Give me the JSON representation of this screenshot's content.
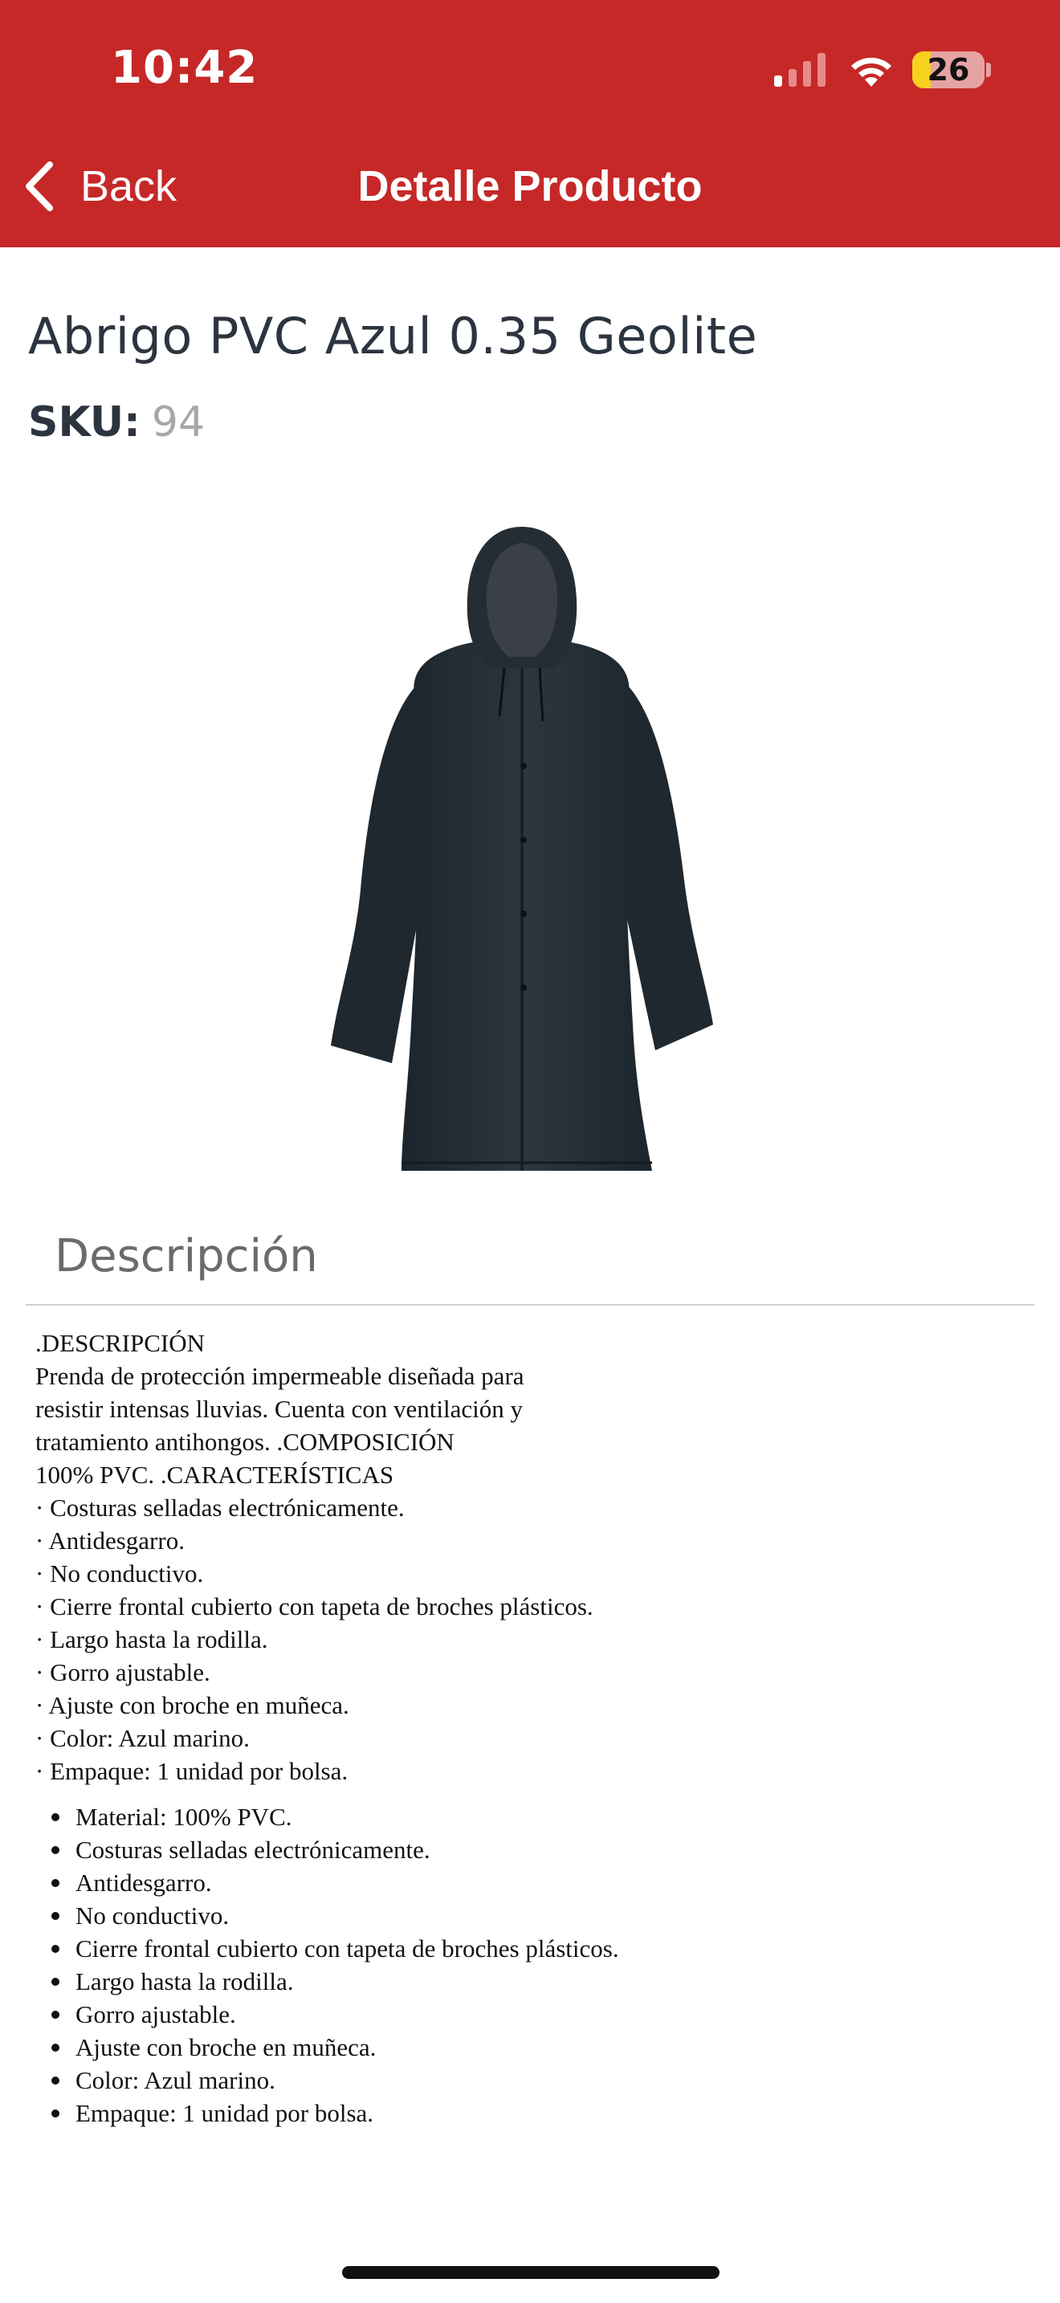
{
  "status_bar": {
    "time": "10:42",
    "battery_level": "26",
    "battery_fraction": 0.26,
    "icons": [
      "signal-icon",
      "wifi-icon",
      "battery-icon"
    ]
  },
  "nav": {
    "back_label": "Back",
    "title": "Detalle Producto",
    "accent_color": "#c62828"
  },
  "product": {
    "name": "Abrigo PVC Azul 0.35 Geolite",
    "sku_label": "SKU:",
    "sku_value": "94",
    "image_icon": "raincoat-image"
  },
  "description": {
    "header": "Descripción",
    "lines": [
      ".DESCRIPCIÓN",
      "Prenda de protección impermeable diseñada para",
      "resistir intensas lluvias. Cuenta con ventilación y",
      "tratamiento antihongos. .COMPOSICIÓN",
      "100% PVC. .CARACTERÍSTICAS",
      "· Costuras selladas electrónicamente.",
      "· Antidesgarro.",
      "· No conductivo.",
      "· Cierre frontal cubierto con tapeta de broches plásticos.",
      "· Largo hasta la rodilla.",
      "· Gorro ajustable.",
      "· Ajuste con broche en muñeca.",
      "· Color: Azul marino.",
      "· Empaque: 1 unidad por bolsa."
    ],
    "bullets": [
      "Material: 100% PVC.",
      "Costuras selladas electrónicamente.",
      "Antidesgarro.",
      "No conductivo.",
      "Cierre frontal cubierto con tapeta de broches plásticos.",
      "Largo hasta la rodilla.",
      "Gorro ajustable.",
      "Ajuste con broche en muñeca.",
      "Color: Azul marino.",
      "Empaque: 1 unidad por bolsa."
    ]
  }
}
